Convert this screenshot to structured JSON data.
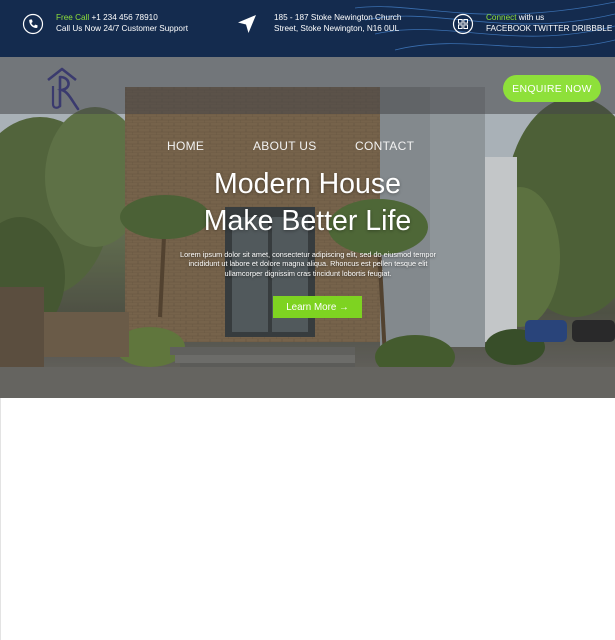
{
  "topbar": {
    "phone": {
      "highlight": "Free Call",
      "number": "+1 234 456 78910",
      "line2": "Call Us Now 24/7 Customer Support",
      "icon": "phone-icon"
    },
    "address": {
      "line1": "185 - 187 Stoke Newington Church",
      "line2": "Street, Stoke Newington, N16 0UL",
      "icon": "location-arrow-icon"
    },
    "social": {
      "highlight": "Connect",
      "rest": " with us",
      "line2": "FACEBOOK TWITTER DRIBBBLE",
      "icon": "qr-grid-icon"
    }
  },
  "nav": {
    "logo": "house-monogram-logo",
    "items": [
      "HOME",
      "ABOUT US",
      "CONTACT"
    ],
    "cta": "ENQUIRE NOW"
  },
  "hero": {
    "title_line1": "Modern House",
    "title_line2": "Make Better Life",
    "lead_line1": "Lorem ipsum dolor sit amet, consectetur adipiscing elit, sed do eiusmod tempor",
    "lead_line2": "incididunt ut labore et dolore magna aliqua. Rhoncus est pellen tesque elit",
    "lead_line3": "ullamcorper dignissim cras tincidunt lobortis feugiat.",
    "button": "Learn More →"
  },
  "colors": {
    "accent": "#8ee03a",
    "topbar": "#142b4e",
    "logo": "#3a3a6e"
  }
}
